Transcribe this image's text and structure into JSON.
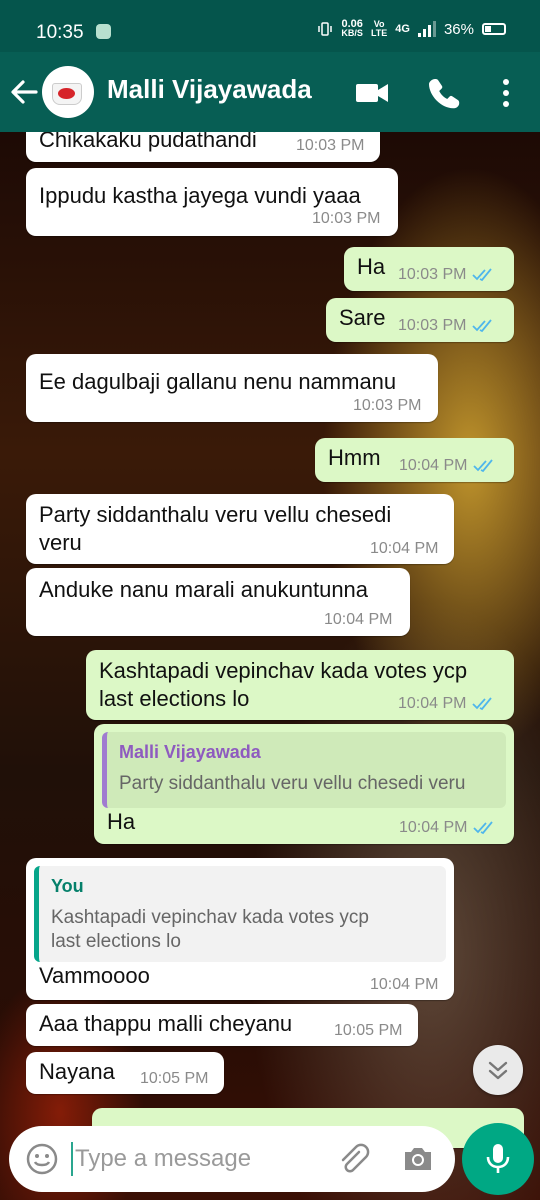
{
  "status_bar": {
    "time": "10:35",
    "net_speed_top": "0.06",
    "net_speed_bottom": "KB/S",
    "volte_top": "Vo",
    "volte_bottom": "LTE",
    "network": "4G",
    "battery": "36%"
  },
  "header": {
    "title": "Malli Vijayawada"
  },
  "icons": {
    "back": "arrow-left-icon",
    "video": "video-camera-icon",
    "phone": "phone-icon",
    "more": "more-vertical-icon",
    "emoji": "emoji-icon",
    "attach": "paperclip-icon",
    "camera": "camera-icon",
    "mic": "microphone-icon",
    "scroll": "chevron-double-down-icon"
  },
  "colors": {
    "header": "#075e54",
    "status_bar": "#05554c",
    "outgoing_bubble": "#dcf8c6",
    "incoming_bubble": "#ffffff",
    "read_tick": "#4fb6ec",
    "mic_button": "#00a884"
  },
  "messages": [
    {
      "dir": "in",
      "text": "Chikakaku pudathandi",
      "time": "10:03 PM"
    },
    {
      "dir": "in",
      "text": "Ippudu kastha jayega vundi yaaa",
      "time": "10:03 PM"
    },
    {
      "dir": "out",
      "text": "Ha",
      "time": "10:03 PM",
      "status": "read"
    },
    {
      "dir": "out",
      "text": "Sare",
      "time": "10:03 PM",
      "status": "read"
    },
    {
      "dir": "in",
      "text": "Ee dagulbaji gallanu nenu nammanu",
      "time": "10:03 PM"
    },
    {
      "dir": "out",
      "text": "Hmm",
      "time": "10:04 PM",
      "status": "read"
    },
    {
      "dir": "in",
      "text_line1": "Party siddanthalu veru vellu chesedi",
      "text_line2": "veru",
      "time": "10:04 PM"
    },
    {
      "dir": "in",
      "text": "Anduke nanu marali anukuntunna",
      "time": "10:04 PM"
    },
    {
      "dir": "out",
      "text_line1": "Kashtapadi vepinchav kada votes ycp",
      "text_line2": "last elections lo",
      "time": "10:04 PM",
      "status": "read"
    },
    {
      "dir": "out",
      "quote_author": "Malli Vijayawada",
      "quote_text": "Party siddanthalu veru vellu chesedi veru",
      "text": "Ha",
      "time": "10:04 PM",
      "status": "read"
    },
    {
      "dir": "in",
      "quote_author": "You",
      "quote_text_line1": "Kashtapadi vepinchav kada votes ycp",
      "quote_text_line2": "last elections lo",
      "text": "Vammoooo",
      "time": "10:04 PM"
    },
    {
      "dir": "in",
      "text": "Aaa thappu malli cheyanu",
      "time": "10:05 PM"
    },
    {
      "dir": "in",
      "text": "Nayana",
      "time": "10:05 PM"
    }
  ],
  "input": {
    "placeholder": "Type a message"
  }
}
